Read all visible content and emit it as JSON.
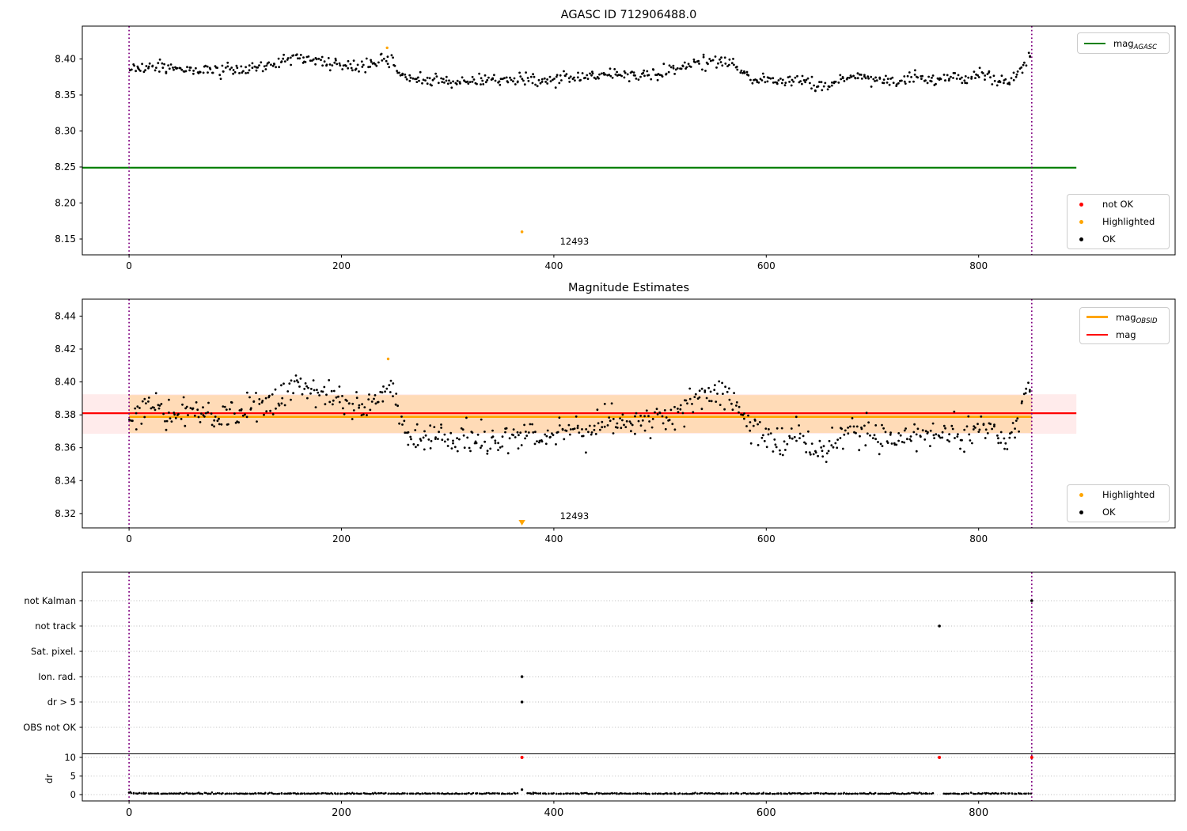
{
  "colors": {
    "ok_marker": "#000000",
    "not_ok_marker": "#ff0000",
    "highlighted_marker": "#ffa500",
    "agasc_line": "#008000",
    "mag_line": "#ff0000",
    "obsid_line": "#ffa500",
    "mag_band": "rgba(255,0,0,0.08)",
    "obsid_band": "rgba(255,165,0,0.22)",
    "obs_vline": "#800080",
    "grid": "#bbbbbb"
  },
  "legends": {
    "agasc": {
      "main": "mag",
      "sub": "AGASC"
    },
    "status_top": {
      "items": [
        {
          "label": "not OK",
          "color": "#ff0000"
        },
        {
          "label": "Highlighted",
          "color": "#ffa500"
        },
        {
          "label": "OK",
          "color": "#000000"
        }
      ]
    },
    "estimates": {
      "items": [
        {
          "main": "mag",
          "sub": "OBSID",
          "color": "#ffa500"
        },
        {
          "main": "mag",
          "sub": "",
          "color": "#ff0000"
        }
      ]
    },
    "status_mid": {
      "items": [
        {
          "label": "Highlighted",
          "color": "#ffa500"
        },
        {
          "label": "OK",
          "color": "#000000"
        }
      ]
    }
  },
  "chart_data": [
    {
      "panel": "mag_agasc",
      "type": "scatter",
      "title": "AGASC ID 712906488.0",
      "xlim": [
        -44,
        985
      ],
      "ylim": [
        8.128,
        8.4456
      ],
      "xticks": [
        0,
        200,
        400,
        600,
        800
      ],
      "yticks": [
        8.15,
        8.2,
        8.25,
        8.3,
        8.35,
        8.4
      ],
      "ytick_labels": [
        "8.15",
        "8.20",
        "8.25",
        "8.30",
        "8.35",
        "8.40"
      ],
      "grid": false,
      "agasc_line": {
        "value": 8.249,
        "span": [
          -44,
          892
        ]
      },
      "obs_vlines": [
        0,
        850
      ],
      "ok_series": {
        "n": 660,
        "x_range": [
          1,
          849
        ],
        "noise_sd": 0.0042,
        "seed": 11,
        "offset": 0,
        "baseline": [
          [
            0,
            8.388
          ],
          [
            25,
            8.39
          ],
          [
            50,
            8.384
          ],
          [
            75,
            8.384
          ],
          [
            100,
            8.386
          ],
          [
            120,
            8.387
          ],
          [
            140,
            8.394
          ],
          [
            152,
            8.401
          ],
          [
            168,
            8.401
          ],
          [
            182,
            8.396
          ],
          [
            200,
            8.392
          ],
          [
            220,
            8.39
          ],
          [
            238,
            8.394
          ],
          [
            248,
            8.4
          ],
          [
            255,
            8.378
          ],
          [
            268,
            8.371
          ],
          [
            290,
            8.369
          ],
          [
            310,
            8.368
          ],
          [
            330,
            8.371
          ],
          [
            350,
            8.368
          ],
          [
            370,
            8.373
          ],
          [
            390,
            8.371
          ],
          [
            410,
            8.375
          ],
          [
            430,
            8.373
          ],
          [
            450,
            8.379
          ],
          [
            470,
            8.377
          ],
          [
            490,
            8.381
          ],
          [
            510,
            8.381
          ],
          [
            522,
            8.391
          ],
          [
            538,
            8.396
          ],
          [
            552,
            8.398
          ],
          [
            566,
            8.396
          ],
          [
            576,
            8.383
          ],
          [
            590,
            8.371
          ],
          [
            602,
            8.373
          ],
          [
            614,
            8.366
          ],
          [
            626,
            8.373
          ],
          [
            638,
            8.369
          ],
          [
            648,
            8.359
          ],
          [
            658,
            8.364
          ],
          [
            670,
            8.371
          ],
          [
            685,
            8.375
          ],
          [
            700,
            8.372
          ],
          [
            715,
            8.369
          ],
          [
            730,
            8.371
          ],
          [
            745,
            8.373
          ],
          [
            760,
            8.371
          ],
          [
            775,
            8.375
          ],
          [
            790,
            8.372
          ],
          [
            802,
            8.377
          ],
          [
            814,
            8.373
          ],
          [
            826,
            8.367
          ],
          [
            836,
            8.38
          ],
          [
            844,
            8.398
          ],
          [
            850,
            8.407
          ]
        ]
      },
      "highlighted_points": [
        [
          243,
          8.4155
        ]
      ],
      "outlier": {
        "x": 370,
        "y": 8.16,
        "label": "12493"
      },
      "legend_top": [
        "mag_AGASC"
      ],
      "legend_bottom": [
        "not OK",
        "Highlighted",
        "OK"
      ]
    },
    {
      "panel": "magnitude_estimates",
      "type": "scatter",
      "title": "Magnitude Estimates",
      "xlim": [
        -44,
        985
      ],
      "ylim": [
        8.3113,
        8.4503
      ],
      "xticks": [
        0,
        200,
        400,
        600,
        800
      ],
      "yticks": [
        8.32,
        8.34,
        8.36,
        8.38,
        8.4,
        8.42,
        8.44
      ],
      "ytick_labels": [
        "8.32",
        "8.34",
        "8.36",
        "8.38",
        "8.40",
        "8.42",
        "8.44"
      ],
      "grid": false,
      "mag_line": {
        "value": 8.381,
        "span": [
          -44,
          892
        ],
        "band": [
          8.3685,
          8.3925
        ]
      },
      "obsid_line": {
        "value": 8.3795,
        "span": [
          0,
          850
        ],
        "band": [
          8.369,
          8.392
        ]
      },
      "obs_vlines": [
        0,
        850
      ],
      "ok_series": {
        "n": 660,
        "x_range": [
          1,
          849
        ],
        "noise_sd": 0.0045,
        "seed": 23,
        "offset": -0.004,
        "baseline": "same_as_panel_1"
      },
      "highlighted_points": [
        [
          244,
          8.414
        ]
      ],
      "clipped_marker": {
        "x": 370,
        "label": "12493",
        "note": "below axis, orange down-triangle"
      },
      "legend_top": [
        "mag_OBSID",
        "mag"
      ],
      "legend_bottom": [
        "Highlighted",
        "OK"
      ]
    },
    {
      "panel": "flags_and_dr",
      "type": "scatter",
      "categories": [
        "not Kalman",
        "not track",
        "Sat. pixel.",
        "Ion. rad.",
        "dr > 5",
        "OBS not OK"
      ],
      "dr_ticks": [
        0,
        5,
        10
      ],
      "dr_tick_labels": [
        "0",
        "5",
        "10"
      ],
      "dr_axis_label": "dr",
      "xticks": [
        0,
        200,
        400,
        600,
        800
      ],
      "xtick_labels": [
        "0",
        "200",
        "400",
        "600",
        "800"
      ],
      "grid": true,
      "obs_vlines": [
        0,
        850
      ],
      "flag_points": [
        {
          "category": "Ion. rad.",
          "x": 370
        },
        {
          "category": "dr > 5",
          "x": 370
        },
        {
          "category": "not track",
          "x": 763
        },
        {
          "category": "not Kalman",
          "x": 850
        }
      ],
      "dr_red_points": [
        {
          "x": 370,
          "dr": 10
        },
        {
          "x": 763,
          "dr": 10
        },
        {
          "x": 850,
          "dr": 10
        }
      ],
      "dr_black_outlier": {
        "x": 370,
        "dr": 1.35
      },
      "dr_series": {
        "n": 660,
        "x_range": [
          0,
          849
        ],
        "base": 0.18,
        "spread": 0.13,
        "seed": 77,
        "gaps": [
          [
            366,
            374
          ],
          [
            759,
            767
          ]
        ]
      }
    }
  ]
}
